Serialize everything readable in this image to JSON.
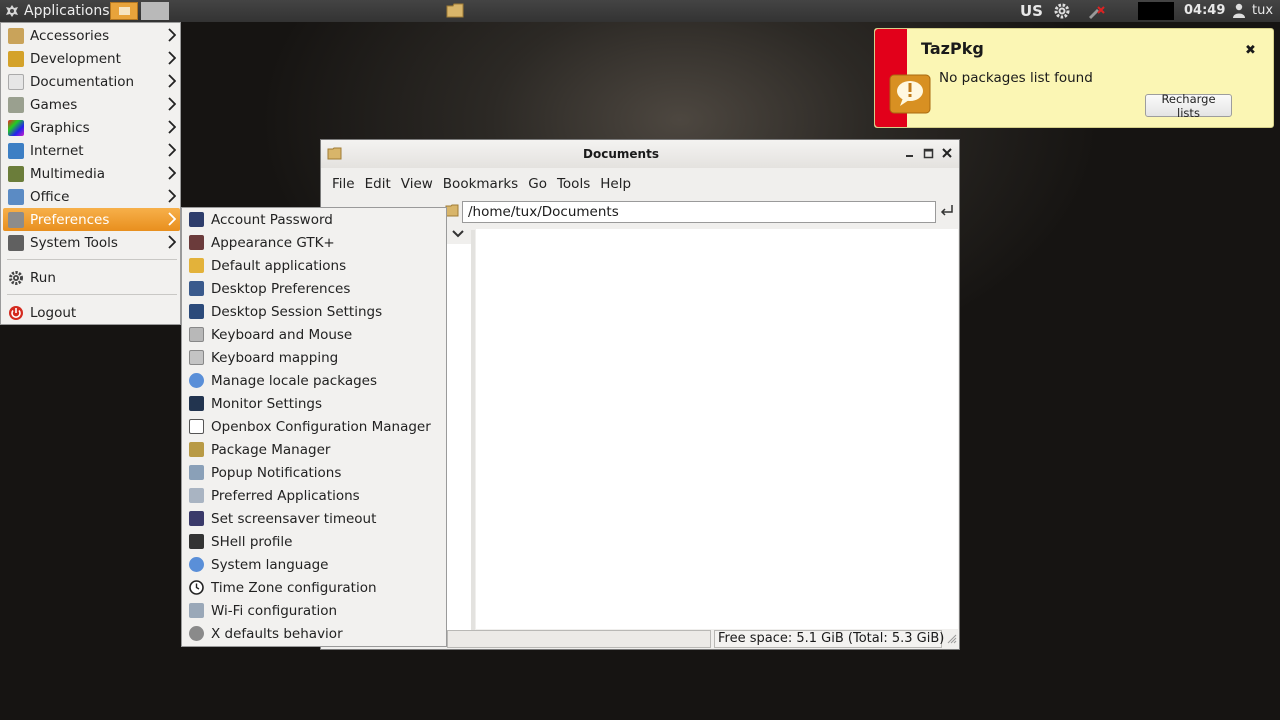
{
  "panel": {
    "applications_label": "Applications",
    "keyboard_layout": "US",
    "clock": "04:49",
    "user": "tux"
  },
  "app_menu": {
    "items": [
      {
        "label": "Accessories",
        "icon": "accessories-icon",
        "color": "#c9a35a"
      },
      {
        "label": "Development",
        "icon": "development-icon",
        "color": "#d4a22a"
      },
      {
        "label": "Documentation",
        "icon": "documentation-icon",
        "color": "#e6e6e6"
      },
      {
        "label": "Games",
        "icon": "games-icon",
        "color": "#9aa08f"
      },
      {
        "label": "Graphics",
        "icon": "graphics-icon",
        "color": "#c02ac0"
      },
      {
        "label": "Internet",
        "icon": "internet-icon",
        "color": "#3d7fc4"
      },
      {
        "label": "Multimedia",
        "icon": "multimedia-icon",
        "color": "#6b7d3a"
      },
      {
        "label": "Office",
        "icon": "office-icon",
        "color": "#5b8bc4"
      },
      {
        "label": "Preferences",
        "icon": "preferences-icon",
        "color": "#8c8c8c"
      },
      {
        "label": "System Tools",
        "icon": "system-tools-icon",
        "color": "#606060"
      }
    ],
    "run_label": "Run",
    "logout_label": "Logout"
  },
  "pref_menu": {
    "items": [
      {
        "label": "Account Password",
        "color": "#2e3d6b"
      },
      {
        "label": "Appearance GTK+",
        "color": "#6b3b3b"
      },
      {
        "label": "Default applications",
        "color": "#e3b23a"
      },
      {
        "label": "Desktop Preferences",
        "color": "#3a5a8c"
      },
      {
        "label": "Desktop Session Settings",
        "color": "#2c4a7a"
      },
      {
        "label": "Keyboard and Mouse",
        "color": "#b8b8b8"
      },
      {
        "label": "Keyboard mapping",
        "color": "#c4c4c4"
      },
      {
        "label": "Manage locale packages",
        "color": "#5a8fd8"
      },
      {
        "label": "Monitor Settings",
        "color": "#22344f"
      },
      {
        "label": "Openbox Configuration Manager",
        "color": "#ffffff"
      },
      {
        "label": "Package Manager",
        "color": "#b89a45"
      },
      {
        "label": "Popup Notifications",
        "color": "#8aa0b8"
      },
      {
        "label": "Preferred Applications",
        "color": "#a9b4c2"
      },
      {
        "label": "Set screensaver timeout",
        "color": "#3a3a6a"
      },
      {
        "label": "SHell profile",
        "color": "#333333"
      },
      {
        "label": "System language",
        "color": "#5a8fd8"
      },
      {
        "label": "Time Zone configuration",
        "color": "#222222"
      },
      {
        "label": "Wi-Fi configuration",
        "color": "#9aa8b8"
      },
      {
        "label": "X defaults behavior",
        "color": "#8a8a8a"
      }
    ]
  },
  "file_manager": {
    "title": "Documents",
    "menus": [
      "File",
      "Edit",
      "View",
      "Bookmarks",
      "Go",
      "Tools",
      "Help"
    ],
    "path": "/home/tux/Documents",
    "status_right": "Free space: 5.1 GiB (Total: 5.3 GiB)"
  },
  "notification": {
    "title": "TazPkg",
    "message": "No packages list found",
    "button_label": "Recharge lists"
  }
}
